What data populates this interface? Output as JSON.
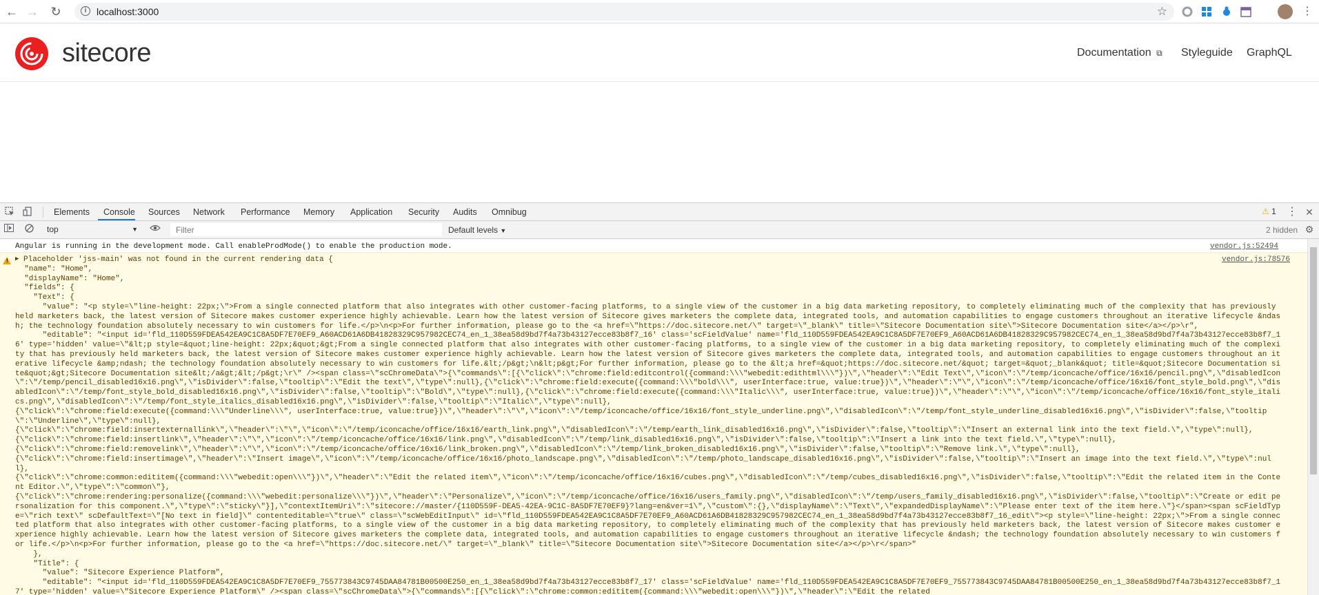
{
  "browser": {
    "url": "localhost:3000"
  },
  "header": {
    "logo_text": "sitecore",
    "nav": [
      {
        "label": "Documentation"
      },
      {
        "label": "Styleguide"
      },
      {
        "label": "GraphQL"
      }
    ]
  },
  "devtools": {
    "tabs": [
      "Elements",
      "Console",
      "Sources",
      "Network",
      "Performance",
      "Memory",
      "Application",
      "Security",
      "Audits",
      "Omnibug"
    ],
    "active_tab": "Console",
    "warning_count": "1",
    "context": "top",
    "filter_placeholder": "Filter",
    "levels": "Default levels",
    "hidden": "2 hidden"
  },
  "console": {
    "info": {
      "text": "Angular is running in the development mode. Call enableProdMode() to enable the production mode.",
      "source": "vendor.js:52494"
    },
    "warning": {
      "source": "vendor.js:78576",
      "text": "Placeholder 'jss-main' was not found in the current rendering data {\n  \"name\": \"Home\",\n  \"displayName\": \"Home\",\n  \"fields\": {\n    \"Text\": {\n      \"value\": \"<p style=\\\"line-height: 22px;\\\">From a single connected platform that also integrates with other customer-facing platforms, to a single view of the customer in a big data marketing repository, to completely eliminating much of the complexity that has previously held marketers back, the latest version of Sitecore makes customer experience highly achievable. Learn how the latest version of Sitecore gives marketers the complete data, integrated tools, and automation capabilities to engage customers throughout an iterative lifecycle &ndash; the technology foundation absolutely necessary to win customers for life.</p>\\n<p>For further information, please go to the <a href=\\\"https://doc.sitecore.net/\\\" target=\\\"_blank\\\" title=\\\"Sitecore Documentation site\\\">Sitecore Documentation site</a></p>\\r\",\n      \"editable\": \"<input id='fld_110D559FDEA542EA9C1C8A5DF7E70EF9_A60ACD61A6DB41828329C957982CEC74_en_1_38ea58d9bd7f4a73b43127ecce83b8f7_16' class='scFieldValue' name='fld_110D559FDEA542EA9C1C8A5DF7E70EF9_A60ACD61A6DB41828329C957982CEC74_en_1_38ea58d9bd7f4a73b43127ecce83b8f7_16' type='hidden' value=\\\"&lt;p style=&quot;line-height: 22px;&quot;&gt;From a single connected platform that also integrates with other customer-facing platforms, to a single view of the customer in a big data marketing repository, to completely eliminating much of the complexity that has previously held marketers back, the latest version of Sitecore makes customer experience highly achievable. Learn how the latest version of Sitecore gives marketers the complete data, integrated tools, and automation capabilities to engage customers throughout an iterative lifecycle &amp;ndash; the technology foundation absolutely necessary to win customers for life.&lt;/p&gt;\\n&lt;p&gt;For further information, please go to the &lt;a href=&quot;https://doc.sitecore.net/&quot; target=&quot;_blank&quot; title=&quot;Sitecore Documentation site&quot;&gt;Sitecore Documentation site&lt;/a&gt;&lt;/p&gt;\\r\\\" /><span class=\\\"scChromeData\\\">{\\\"commands\\\":[{\\\"click\\\":\\\"chrome:field:editcontrol({command:\\\\\\\"webedit:edithtml\\\\\\\"})\\\",\\\"header\\\":\\\"Edit Text\\\",\\\"icon\\\":\\\"/temp/iconcache/office/16x16/pencil.png\\\",\\\"disabledIcon\\\":\\\"/temp/pencil_disabled16x16.png\\\",\\\"isDivider\\\":false,\\\"tooltip\\\":\\\"Edit the text\\\",\\\"type\\\":null},{\\\"click\\\":\\\"chrome:field:execute({command:\\\\\\\"bold\\\\\\\", userInterface:true, value:true})\\\",\\\"header\\\":\\\"\\\",\\\"icon\\\":\\\"/temp/iconcache/office/16x16/font_style_bold.png\\\",\\\"disabledIcon\\\":\\\"/temp/font_style_bold_disabled16x16.png\\\",\\\"isDivider\\\":false,\\\"tooltip\\\":\\\"Bold\\\",\\\"type\\\":null},{\\\"click\\\":\\\"chrome:field:execute({command:\\\\\\\"Italic\\\\\\\", userInterface:true, value:true})\\\",\\\"header\\\":\\\"\\\",\\\"icon\\\":\\\"/temp/iconcache/office/16x16/font_style_italics.png\\\",\\\"disabledIcon\\\":\\\"/temp/font_style_italics_disabled16x16.png\\\",\\\"isDivider\\\":false,\\\"tooltip\\\":\\\"Italic\\\",\\\"type\\\":null},\n{\\\"click\\\":\\\"chrome:field:execute({command:\\\\\\\"Underline\\\\\\\", userInterface:true, value:true})\\\",\\\"header\\\":\\\"\\\",\\\"icon\\\":\\\"/temp/iconcache/office/16x16/font_style_underline.png\\\",\\\"disabledIcon\\\":\\\"/temp/font_style_underline_disabled16x16.png\\\",\\\"isDivider\\\":false,\\\"tooltip\\\":\\\"Underline\\\",\\\"type\\\":null},\n{\\\"click\\\":\\\"chrome:field:insertexternallink\\\",\\\"header\\\":\\\"\\\",\\\"icon\\\":\\\"/temp/iconcache/office/16x16/earth_link.png\\\",\\\"disabledIcon\\\":\\\"/temp/earth_link_disabled16x16.png\\\",\\\"isDivider\\\":false,\\\"tooltip\\\":\\\"Insert an external link into the text field.\\\",\\\"type\\\":null},\n{\\\"click\\\":\\\"chrome:field:insertlink\\\",\\\"header\\\":\\\"\\\",\\\"icon\\\":\\\"/temp/iconcache/office/16x16/link.png\\\",\\\"disabledIcon\\\":\\\"/temp/link_disabled16x16.png\\\",\\\"isDivider\\\":false,\\\"tooltip\\\":\\\"Insert a link into the text field.\\\",\\\"type\\\":null},\n{\\\"click\\\":\\\"chrome:field:removelink\\\",\\\"header\\\":\\\"\\\",\\\"icon\\\":\\\"/temp/iconcache/office/16x16/link_broken.png\\\",\\\"disabledIcon\\\":\\\"/temp/link_broken_disabled16x16.png\\\",\\\"isDivider\\\":false,\\\"tooltip\\\":\\\"Remove link.\\\",\\\"type\\\":null},\n{\\\"click\\\":\\\"chrome:field:insertimage\\\",\\\"header\\\":\\\"Insert image\\\",\\\"icon\\\":\\\"/temp/iconcache/office/16x16/photo_landscape.png\\\",\\\"disabledIcon\\\":\\\"/temp/photo_landscape_disabled16x16.png\\\",\\\"isDivider\\\":false,\\\"tooltip\\\":\\\"Insert an image into the text field.\\\",\\\"type\\\":null},\n{\\\"click\\\":\\\"chrome:common:edititem({command:\\\\\\\"webedit:open\\\\\\\"})\\\",\\\"header\\\":\\\"Edit the related item\\\",\\\"icon\\\":\\\"/temp/iconcache/office/16x16/cubes.png\\\",\\\"disabledIcon\\\":\\\"/temp/cubes_disabled16x16.png\\\",\\\"isDivider\\\":false,\\\"tooltip\\\":\\\"Edit the related item in the Content Editor.\\\",\\\"type\\\":\\\"common\\\"},\n{\\\"click\\\":\\\"chrome:rendering:personalize({command:\\\\\\\"webedit:personalize\\\\\\\"})\\\",\\\"header\\\":\\\"Personalize\\\",\\\"icon\\\":\\\"/temp/iconcache/office/16x16/users_family.png\\\",\\\"disabledIcon\\\":\\\"/temp/users_family_disabled16x16.png\\\",\\\"isDivider\\\":false,\\\"tooltip\\\":\\\"Create or edit personalization for this component.\\\",\\\"type\\\":\\\"sticky\\\"}],\\\"contextItemUri\\\":\\\"sitecore://master/{110D559F-DEA5-42EA-9C1C-8A5DF7E70EF9}?lang=en&ver=1\\\",\\\"custom\\\":{},\\\"displayName\\\":\\\"Text\\\",\\\"expandedDisplayName\\\":\\\"Please enter text of the item here.\\\"}</span><span scFieldType=\\\"rich text\\\" scDefaultText=\\\"[No text in field]\\\" contenteditable=\\\"true\\\" class=\\\"scWebEditInput\\\" id=\\\"fld_110D559FDEA542EA9C1C8A5DF7E70EF9_A60ACD61A6DB41828329C957982CEC74_en_1_38ea58d9bd7f4a73b43127ecce83b8f7_16_edit\\\"><p style=\\\"line-height: 22px;\\\">From a single connected platform that also integrates with other customer-facing platforms, to a single view of the customer in a big data marketing repository, to completely eliminating much of the complexity that has previously held marketers back, the latest version of Sitecore makes customer experience highly achievable. Learn how the latest version of Sitecore gives marketers the complete data, integrated tools, and automation capabilities to engage customers throughout an iterative lifecycle &ndash; the technology foundation absolutely necessary to win customers for life.</p>\\n<p>For further information, please go to the <a href=\\\"https://doc.sitecore.net/\\\" target=\\\"_blank\\\" title=\\\"Sitecore Documentation site\\\">Sitecore Documentation site</a></p>\\r</span>\"\n    },\n    \"Title\": {\n      \"value\": \"Sitecore Experience Platform\",\n      \"editable\": \"<input id='fld_110D559FDEA542EA9C1C8A5DF7E70EF9_755773843C9745DAA84781B00500E250_en_1_38ea58d9bd7f4a73b43127ecce83b8f7_17' class='scFieldValue' name='fld_110D559FDEA542EA9C1C8A5DF7E70EF9_755773843C9745DAA84781B00500E250_en_1_38ea58d9bd7f4a73b43127ecce83b8f7_17' type='hidden' value=\\\"Sitecore Experience Platform\\\" /><span class=\\\"scChromeData\\\">{\\\"commands\\\":[{\\\"click\\\":\\\"chrome:common:edititem({command:\\\\\\\"webedit:open\\\\\\\"})\\\",\\\"header\\\":\\\"Edit the related"
    }
  },
  "colors": {
    "accent": "#1a73e8",
    "brand_red": "#eb1f1f",
    "warning_bg": "#fffbe5",
    "warning_text": "#5c3c00"
  }
}
